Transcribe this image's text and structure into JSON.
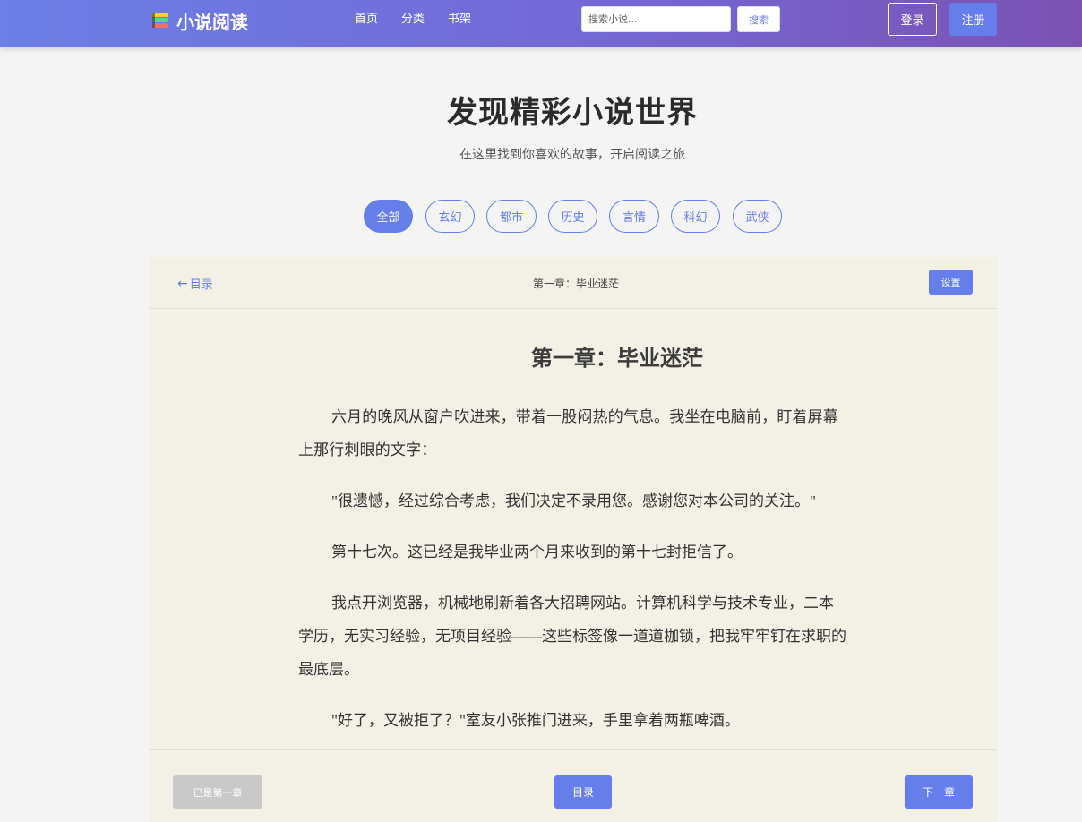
{
  "brand": {
    "name": "小说阅读",
    "icon": "books-icon"
  },
  "nav": {
    "items": [
      "首页",
      "分类",
      "书架"
    ]
  },
  "search": {
    "placeholder": "搜索小说...",
    "value": "",
    "button": "搜索"
  },
  "auth": {
    "login": "登录",
    "register": "注册"
  },
  "hero": {
    "title": "发现精彩小说世界",
    "subtitle": "在这里找到你喜欢的故事，开启阅读之旅"
  },
  "categories": {
    "items": [
      "全部",
      "玄幻",
      "都市",
      "历史",
      "言情",
      "科幻",
      "武侠"
    ],
    "active": "全部"
  },
  "reader": {
    "back_label": "目录",
    "back_icon": "arrow-left-icon",
    "header_chapter": "第一章：毕业迷茫",
    "settings": "设置",
    "chapter_title": "第一章：毕业迷茫",
    "paragraphs": [
      "六月的晚风从窗户吹进来，带着一股闷热的气息。我坐在电脑前，盯着屏幕上那行刺眼的文字：",
      "\"很遗憾，经过综合考虑，我们决定不录用您。感谢您对本公司的关注。\"",
      "第十七次。这已经是我毕业两个月来收到的第十七封拒信了。",
      "我点开浏览器，机械地刷新着各大招聘网站。计算机科学与技术专业，二本学历，无实习经验，无项目经验——这些标签像一道道枷锁，把我牢牢钉在求职的最底层。",
      "\"好了，又被拒了？\"室友小张推门进来，手里拿着两瓶啤酒。"
    ],
    "footer": {
      "prev": "已是第一章",
      "toc": "目录",
      "next": "下一章"
    }
  },
  "colors": {
    "accent": "#667eea",
    "nav_gradient_start": "#6b7fe6",
    "nav_gradient_end": "#7b52b3",
    "reader_bg": "#f3f1e6",
    "disabled": "#c9c9c9"
  }
}
